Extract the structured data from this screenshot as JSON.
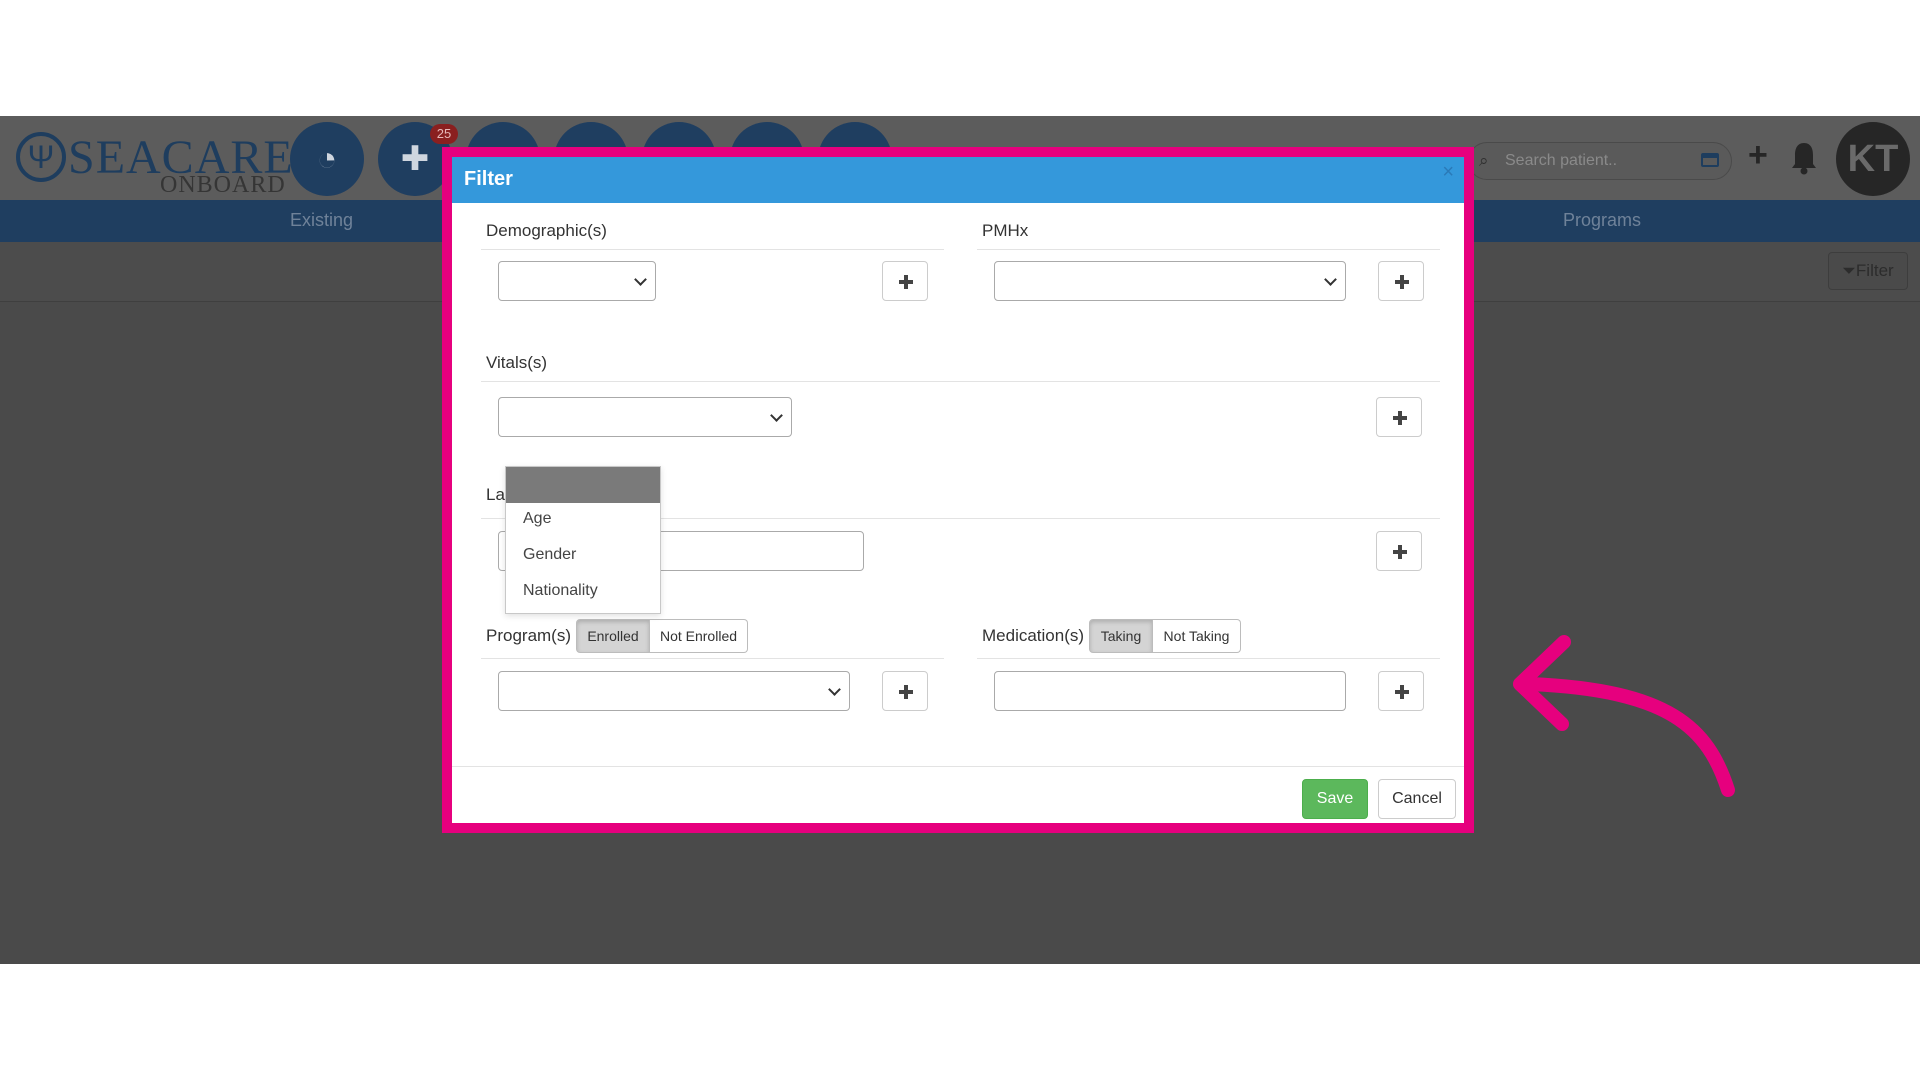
{
  "app": {
    "logo_main": "SEACARE",
    "logo_sub": "ONBOARD",
    "notification_count": "25",
    "search_placeholder": "Search patient..",
    "avatar_initials": "KT",
    "nav": [
      "Existing",
      "Programs"
    ],
    "filter_button": "Filter"
  },
  "modal": {
    "title": "Filter",
    "close_symbol": "×",
    "sections": {
      "demographics": "Demographic(s)",
      "pmhx": "PMHx",
      "vitals": "Vitals(s)",
      "labs_partial": "La",
      "programs": "Program(s)",
      "medications": "Medication(s)"
    },
    "program_toggle": [
      "Enrolled",
      "Not Enrolled"
    ],
    "program_active": "Enrolled",
    "medication_toggle": [
      "Taking",
      "Not Taking"
    ],
    "medication_active": "Taking",
    "dropdown_options": [
      "Age",
      "Gender",
      "Nationality"
    ],
    "save_label": "Save",
    "cancel_label": "Cancel"
  },
  "colors": {
    "highlight": "#e6007e",
    "modal_header": "#3498db",
    "save": "#5cb85c",
    "nav_bar": "#1f3e60"
  }
}
